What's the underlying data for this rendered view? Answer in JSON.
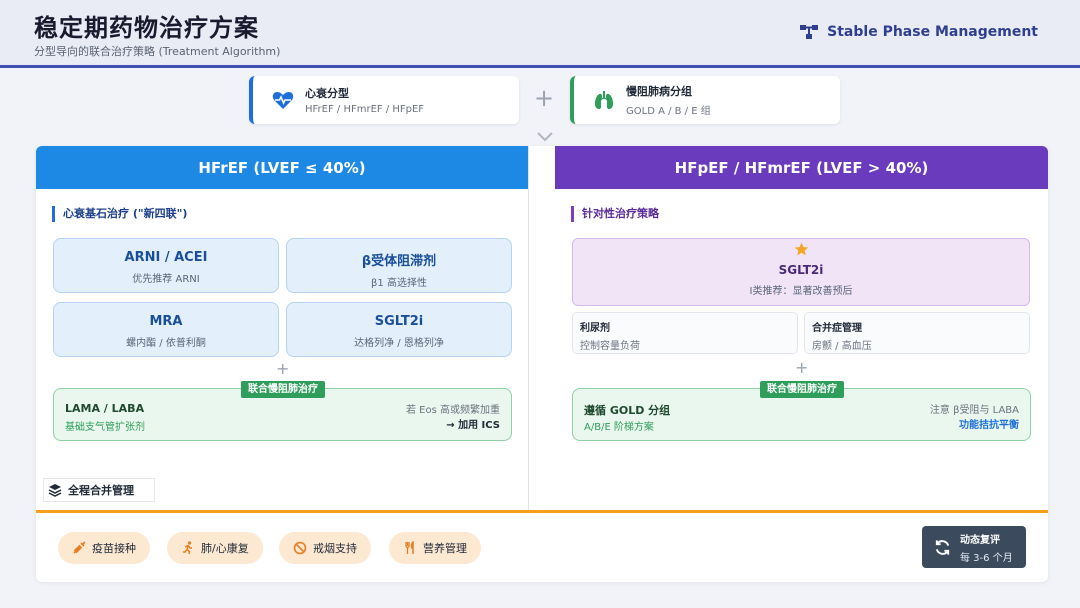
{
  "header": {
    "title": "稳定期药物治疗方案",
    "subtitle": "分型导向的联合治疗策略 (Treatment Algorithm)",
    "brand": "Stable Phase Management"
  },
  "classification": {
    "hf": {
      "title": "心衰分型",
      "subtitle": "HFrEF / HFmrEF / HFpEF",
      "icon": "heartbeat-icon"
    },
    "copd": {
      "title": "慢阻肺病分组",
      "subtitle": "GOLD A / B / E 组",
      "icon": "lungs-icon"
    },
    "connector": "+"
  },
  "left": {
    "header": "HFrEF (LVEF ≤ 40%)",
    "section_label": "心衰基石治疗 (\"新四联\")",
    "drugs": [
      {
        "name": "ARNI / ACEI",
        "desc": "优先推荐 ARNI"
      },
      {
        "name": "β受体阻滞剂",
        "desc": "β1 高选择性"
      },
      {
        "name": "MRA",
        "desc": "螺内酯 / 依普利酮"
      },
      {
        "name": "SGLT2i",
        "desc": "达格列净 / 恩格列净"
      }
    ],
    "plus": "+",
    "copd": {
      "tag": "联合慢阻肺治疗",
      "title": "LAMA / LABA",
      "subtitle": "基础支气管扩张剂",
      "note": "若 Eos 高或频繁加重",
      "action": "→ 加用 ICS"
    },
    "holistic": "全程合并管理"
  },
  "right": {
    "header": "HFpEF / HFmrEF (LVEF > 40%)",
    "section_label": "针对性治疗策略",
    "main_drug": {
      "name": "SGLT2i",
      "desc": "I类推荐：显著改善预后"
    },
    "mini": [
      {
        "name": "利尿剂",
        "desc": "控制容量负荷"
      },
      {
        "name": "合并症管理",
        "desc": "房颤 / 高血压"
      }
    ],
    "plus": "+",
    "copd": {
      "tag": "联合慢阻肺治疗",
      "title": "遵循 GOLD 分组",
      "subtitle": "A/B/E 阶梯方案",
      "note": "注意 β受阻与 LABA",
      "action": "功能拮抗平衡"
    }
  },
  "footer": {
    "items": [
      {
        "label": "疫苗接种",
        "icon": "vaccine-icon"
      },
      {
        "label": "肺/心康复",
        "icon": "running-icon"
      },
      {
        "label": "戒烟支持",
        "icon": "no-smoking-icon"
      },
      {
        "label": "营养管理",
        "icon": "utensils-icon"
      }
    ],
    "reassess": {
      "title": "动态复评",
      "subtitle": "每 3-6 个月",
      "icon": "refresh-icon"
    }
  },
  "colors": {
    "hfref": "#1e88e5",
    "hfpef": "#6a3bbd",
    "copd": "#2e9e5a",
    "accent": "#f59f1e",
    "header_rule": "#3f51b5"
  }
}
